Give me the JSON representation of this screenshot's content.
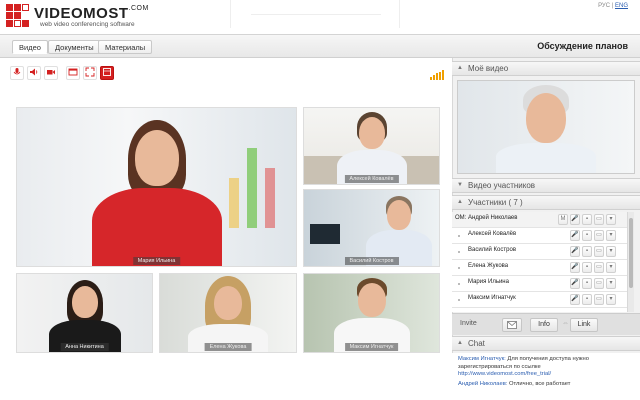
{
  "brand": {
    "name": "VIDEOMOST",
    "domain_suffix": ".COM",
    "tagline": "web video conferencing software"
  },
  "language": {
    "ru": "РУС",
    "separator": "|",
    "en": "ENG"
  },
  "tabs": [
    {
      "label": "Видео",
      "active": true
    },
    {
      "label": "Документы",
      "active": false
    },
    {
      "label": "Материалы",
      "active": false
    }
  ],
  "conference_title": "Обсуждение планов",
  "toolbar": [
    {
      "icon": "microphone-icon",
      "glyph": "🎙"
    },
    {
      "icon": "speaker-icon",
      "glyph": "🔈"
    },
    {
      "icon": "camera-icon",
      "glyph": "■"
    },
    {
      "icon": "window-icon",
      "glyph": "▭"
    },
    {
      "icon": "fullscreen-icon",
      "glyph": "⤢"
    },
    {
      "icon": "grid-layout-icon",
      "glyph": "▦",
      "active": true
    }
  ],
  "videos": [
    {
      "name": "Мария Ильина"
    },
    {
      "name": "Алексей Ковалёв"
    },
    {
      "name": "Василий Костров"
    },
    {
      "name": "Анна Никитина"
    },
    {
      "name": "Елена Жукова"
    },
    {
      "name": "Максим Игнатчук"
    }
  ],
  "panels": {
    "my_video": "Моё видео",
    "participant_video": "Видео участников",
    "participants": "Участники ( 7 )",
    "chat": "Chat"
  },
  "participants": [
    {
      "name": "ОМ: Андрей Николаев",
      "host": true
    },
    {
      "name": "Алексей Ковалёв"
    },
    {
      "name": "Василий Костров"
    },
    {
      "name": "Елена Жукова"
    },
    {
      "name": "Мария Ильина"
    },
    {
      "name": "Максим Игнатчук"
    }
  ],
  "invite": {
    "label": "Invite",
    "info": "Info",
    "link": "Link"
  },
  "chat": {
    "messages": [
      {
        "author": "Максим Игнатчук:",
        "text": "Для получения доступа нужно зарегистрироваться по ссылке",
        "link": "http://www.videomost.com/free_trial/"
      },
      {
        "author": "Андрей Николаев:",
        "text": "Отлично, все работает"
      }
    ]
  },
  "colors": {
    "brand_red": "#d42121",
    "link_blue": "#2a5db0",
    "signal_orange": "#f0a000"
  }
}
